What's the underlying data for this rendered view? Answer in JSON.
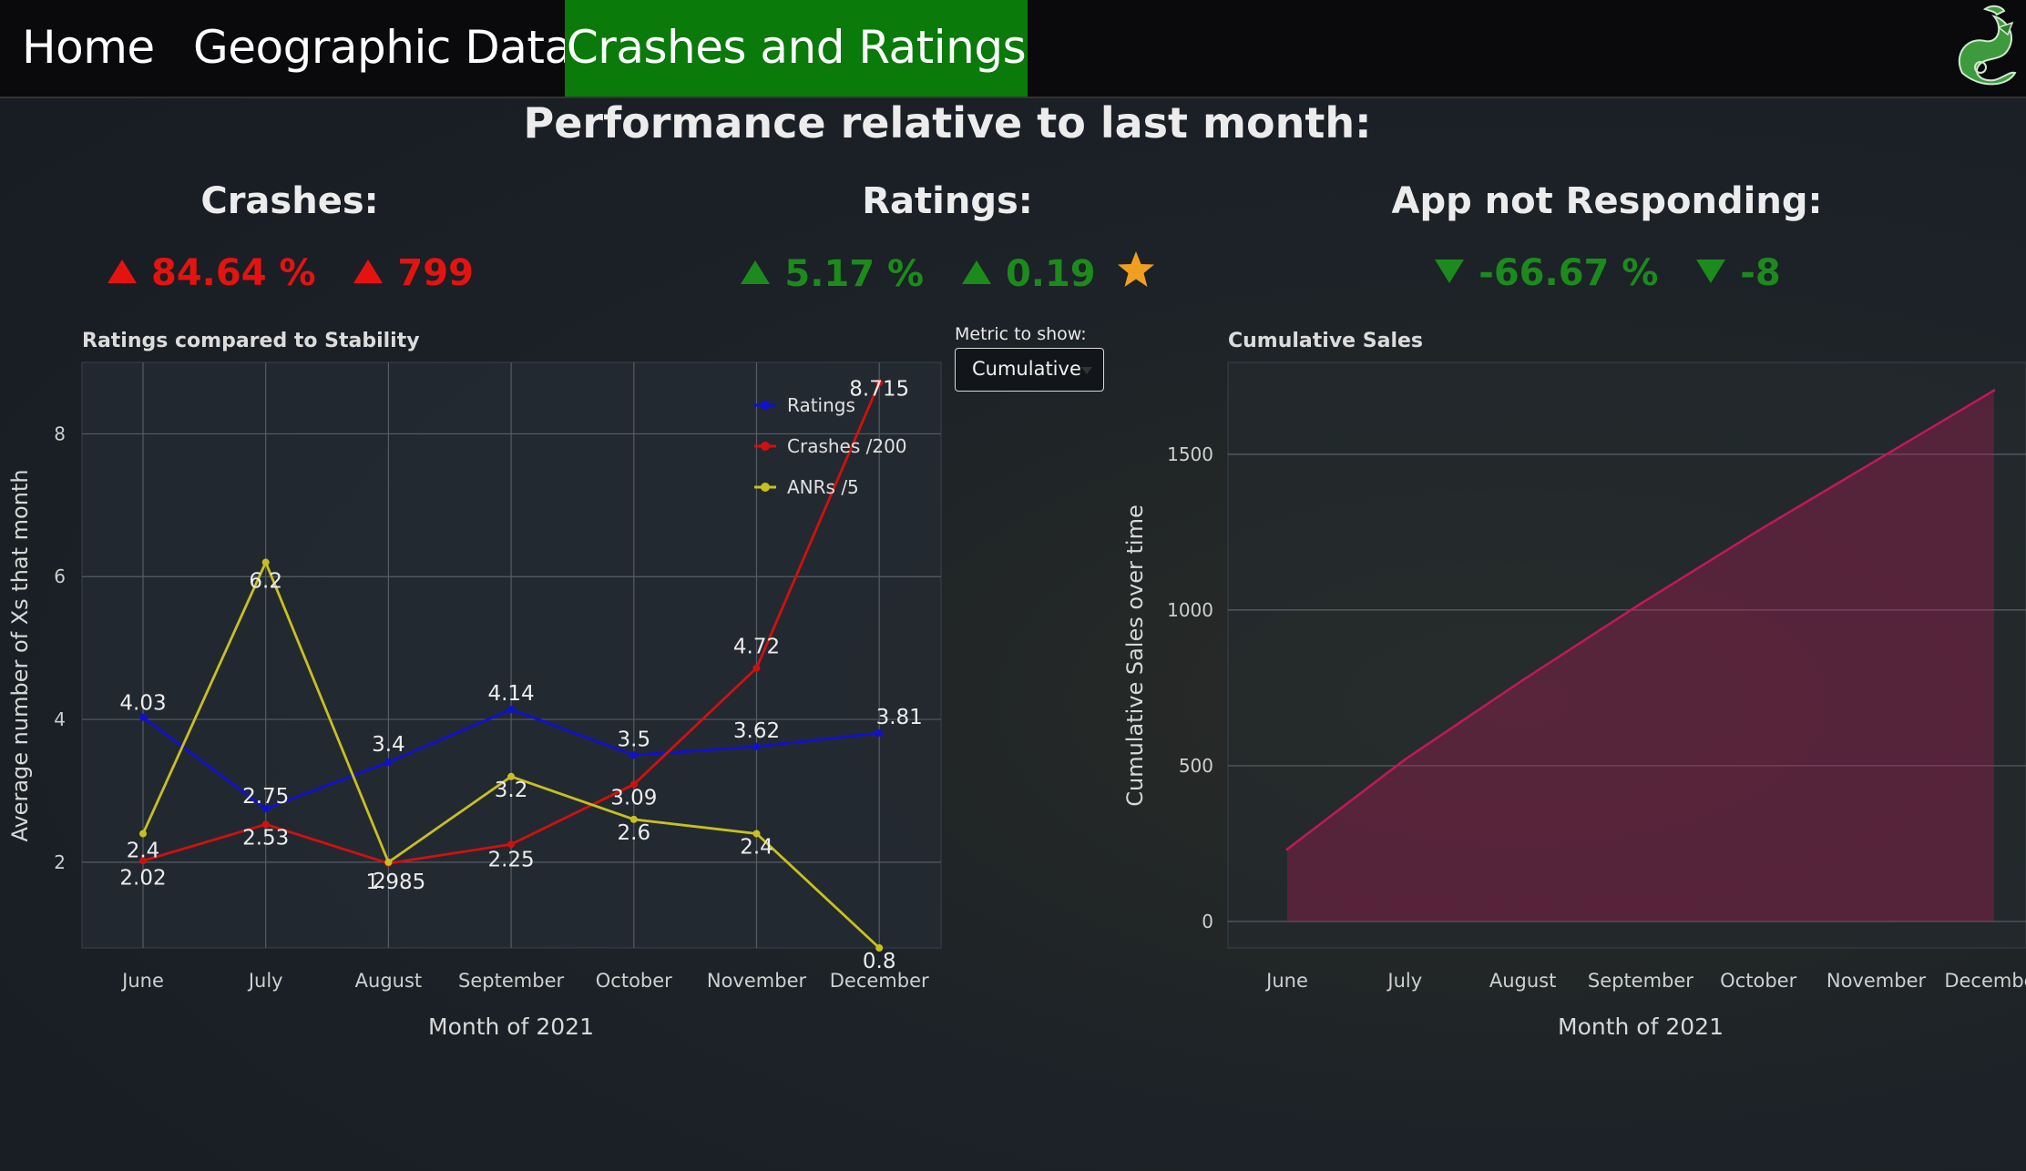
{
  "nav": {
    "items": [
      {
        "label": "Home",
        "active": false
      },
      {
        "label": "Geographic Data",
        "active": false
      },
      {
        "label": "Crashes and Ratings",
        "active": true
      }
    ],
    "logo_icon": "dragon-logo-icon"
  },
  "performance": {
    "title": "Performance relative to last month:",
    "crashes": {
      "label": "Crashes:",
      "pct": "84.64 %",
      "abs": "799",
      "direction": "up",
      "color": "#e5130f"
    },
    "ratings": {
      "label": "Ratings:",
      "pct": "5.17 %",
      "abs": "0.19",
      "direction": "up",
      "color": "#1d8a1d",
      "icon": "star-icon"
    },
    "anr": {
      "label": "App not Responding:",
      "pct": "-66.67 %",
      "abs": "-8",
      "direction": "down",
      "color": "#1d8a1d"
    }
  },
  "controls": {
    "metric_label": "Metric to show:",
    "metric_value": "Cumulative"
  },
  "chart_data": [
    {
      "type": "line",
      "title": "Ratings compared to Stability",
      "xlabel": "Month of 2021",
      "ylabel": "Average number of Xs that month",
      "categories": [
        "June",
        "July",
        "August",
        "September",
        "October",
        "November",
        "December"
      ],
      "ylim": [
        0.8,
        9.0
      ],
      "yticks": [
        2,
        4,
        6,
        8
      ],
      "grid": true,
      "legend_position": "top-right",
      "series": [
        {
          "name": "Ratings",
          "color": "#1010d0",
          "values": [
            4.03,
            2.75,
            3.4,
            4.14,
            3.5,
            3.62,
            3.81
          ],
          "labels": [
            "4.03",
            "2.75",
            "3.4",
            "4.14",
            "3.5",
            "3.62",
            "3.81"
          ]
        },
        {
          "name": "Crashes /200",
          "color": "#d01010",
          "values": [
            2.02,
            2.53,
            1.985,
            2.25,
            3.09,
            4.72,
            8.715
          ],
          "labels": [
            "2.02",
            "2.53",
            "1.985",
            "2.25",
            "3.09",
            "4.72",
            "8.715"
          ]
        },
        {
          "name": "ANRs /5",
          "color": "#c8c020",
          "values": [
            2.4,
            6.2,
            2,
            3.2,
            2.6,
            2.4,
            0.8
          ],
          "labels": [
            "2.4",
            "6.2",
            "2",
            "3.2",
            "2.6",
            "2.4",
            "0.8"
          ]
        }
      ]
    },
    {
      "type": "area",
      "title": "Cumulative Sales",
      "xlabel": "Month of 2021",
      "ylabel": "Cumulative Sales over time",
      "categories": [
        "June",
        "July",
        "August",
        "September",
        "October",
        "November",
        "December"
      ],
      "values": [
        232,
        520,
        775,
        1020,
        1255,
        1480,
        1705
      ],
      "ylim": [
        -85,
        1795
      ],
      "yticks": [
        0,
        500,
        1000,
        1500
      ],
      "grid": true,
      "color": "#c2185b"
    }
  ]
}
